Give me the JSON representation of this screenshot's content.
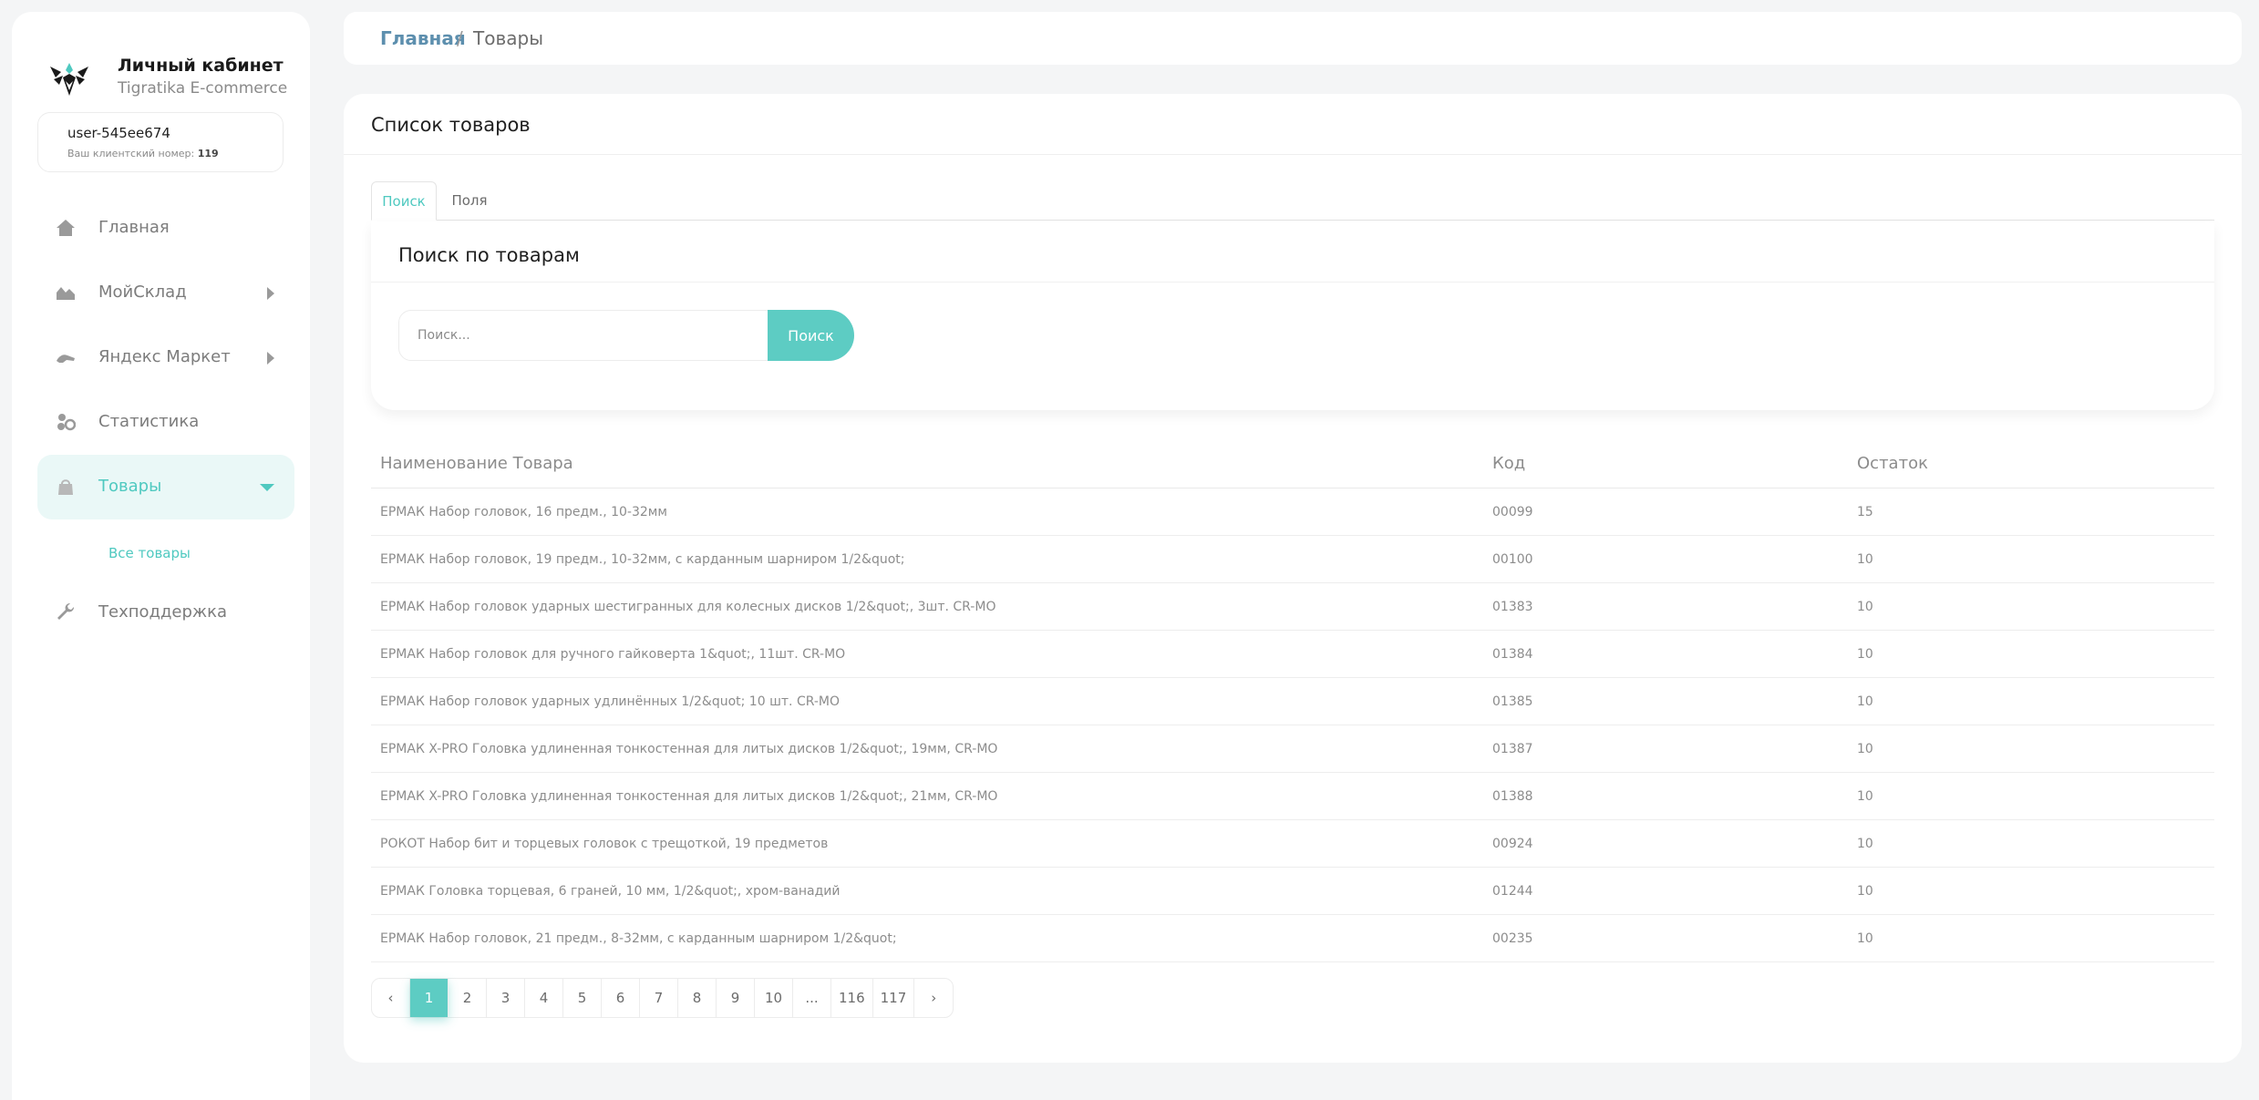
{
  "brand": {
    "title": "Личный кабинет",
    "subtitle": "Tigratika E-commerce"
  },
  "user": {
    "name": "user-545ee674",
    "client_label": "Ваш клиентский номер:",
    "client_number": "119"
  },
  "sidebar": {
    "items": [
      {
        "label": "Главная",
        "icon": "home-icon"
      },
      {
        "label": "МойСклад",
        "icon": "warehouse-icon"
      },
      {
        "label": "Яндекс Маркет",
        "icon": "market-icon"
      },
      {
        "label": "Статистика",
        "icon": "statistics-icon"
      },
      {
        "label": "Товары",
        "icon": "bag-icon"
      },
      {
        "label": "Техподдержка",
        "icon": "wrench-icon"
      }
    ],
    "sub_item": "Все товары"
  },
  "breadcrumb": {
    "home": "Главная",
    "separator": "/",
    "current": "Товары"
  },
  "card": {
    "title": "Список товаров"
  },
  "tabs": [
    "Поиск",
    "Поля"
  ],
  "search": {
    "title": "Поиск по товарам",
    "placeholder": "Поиск...",
    "button": "Поиск"
  },
  "table": {
    "headers": [
      "Наименование Товара",
      "Код",
      "Остаток"
    ],
    "rows": [
      [
        "ЕРМАК Набор головок, 16 предм., 10-32мм",
        "00099",
        "15"
      ],
      [
        "ЕРМАК Набор головок, 19 предм., 10-32мм, с карданным шарниром 1/2&quot;",
        "00100",
        "10"
      ],
      [
        "ЕРМАК Набор головок ударных шестигранных для колесных дисков 1/2&quot;, 3шт. CR-MO",
        "01383",
        "10"
      ],
      [
        "ЕРМАК Набор головок для ручного гайковерта 1&quot;, 11шт. CR-MO",
        "01384",
        "10"
      ],
      [
        "ЕРМАК Набор головок ударных удлинённых 1/2&quot; 10 шт. CR-MO",
        "01385",
        "10"
      ],
      [
        "ЕРМАК X-PRO Головка удлиненная тонкостенная для литых дисков 1/2&quot;, 19мм, CR-MO",
        "01387",
        "10"
      ],
      [
        "ЕРМАК X-PRO Головка удлиненная тонкостенная для литых дисков 1/2&quot;, 21мм, CR-MO",
        "01388",
        "10"
      ],
      [
        "РОКОТ Набор бит и торцевых головок с трещоткой, 19 предметов",
        "00924",
        "10"
      ],
      [
        "ЕРМАК Головка торцевая, 6 граней, 10 мм, 1/2&quot;, хром-ванадий",
        "01244",
        "10"
      ],
      [
        "ЕРМАК Набор головок, 21 предм., 8-32мм, с карданным шарниром 1/2&quot;",
        "00235",
        "10"
      ]
    ]
  },
  "pagination": {
    "prev": "‹",
    "next": "›",
    "pages": [
      "1",
      "2",
      "3",
      "4",
      "5",
      "6",
      "7",
      "8",
      "9",
      "10",
      "...",
      "116",
      "117"
    ],
    "current": "1"
  },
  "colors": {
    "accent": "#5dccc3",
    "breadcrumb_link": "#5d8fae",
    "background": "#f4f5f6"
  }
}
